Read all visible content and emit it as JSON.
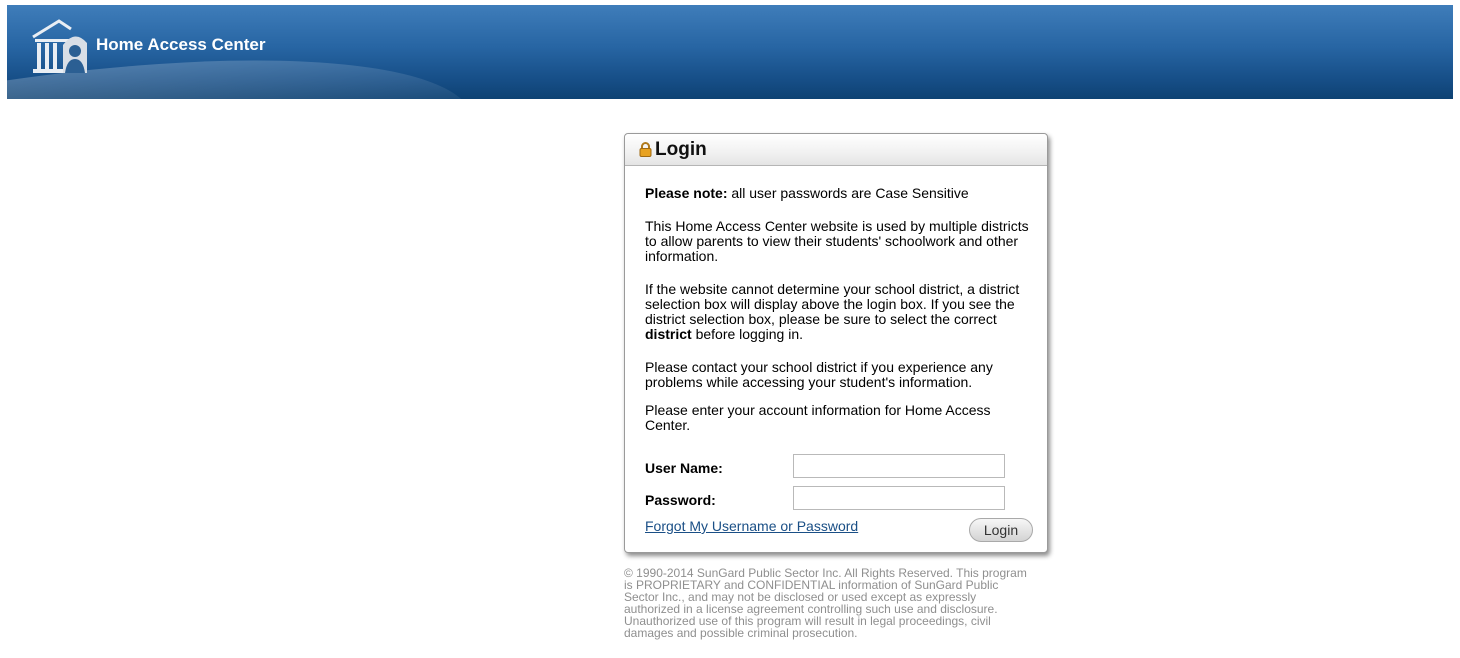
{
  "header": {
    "title": "Home Access Center",
    "logo_icon": "courthouse-person-icon",
    "colors": {
      "top": "#3f7dba",
      "bottom": "#0e4273"
    }
  },
  "login": {
    "title": "Login",
    "title_icon": "padlock-icon",
    "note_bold": "Please note:",
    "note_text": " all user passwords are Case Sensitive",
    "para1": "This Home Access Center website is used by multiple districts to allow parents to view their students' schoolwork and other information.",
    "para2_a": "If the website cannot determine your school district, a district selection box will display above the login box. If you see the district selection box, please be sure to select the correct ",
    "para2_bold": "district",
    "para2_b": " before logging in.",
    "para3": "Please contact your school district if you experience any problems while accessing your student's information.",
    "para4": "Please enter your account information for Home Access Center.",
    "username_label": "User Name:",
    "username_value": "",
    "password_label": "Password:",
    "password_value": "",
    "forgot_link": "Forgot My Username or Password",
    "login_button": "Login"
  },
  "footer": {
    "copyright": "© 1990-2014 SunGard Public Sector Inc. All Rights Reserved. This program is PROPRIETARY and CONFIDENTIAL information of SunGard Public Sector Inc., and may not be disclosed or used except as expressly authorized in a license agreement controlling such use and disclosure. Unauthorized use of this program will result in legal proceedings, civil damages and possible criminal prosecution."
  }
}
